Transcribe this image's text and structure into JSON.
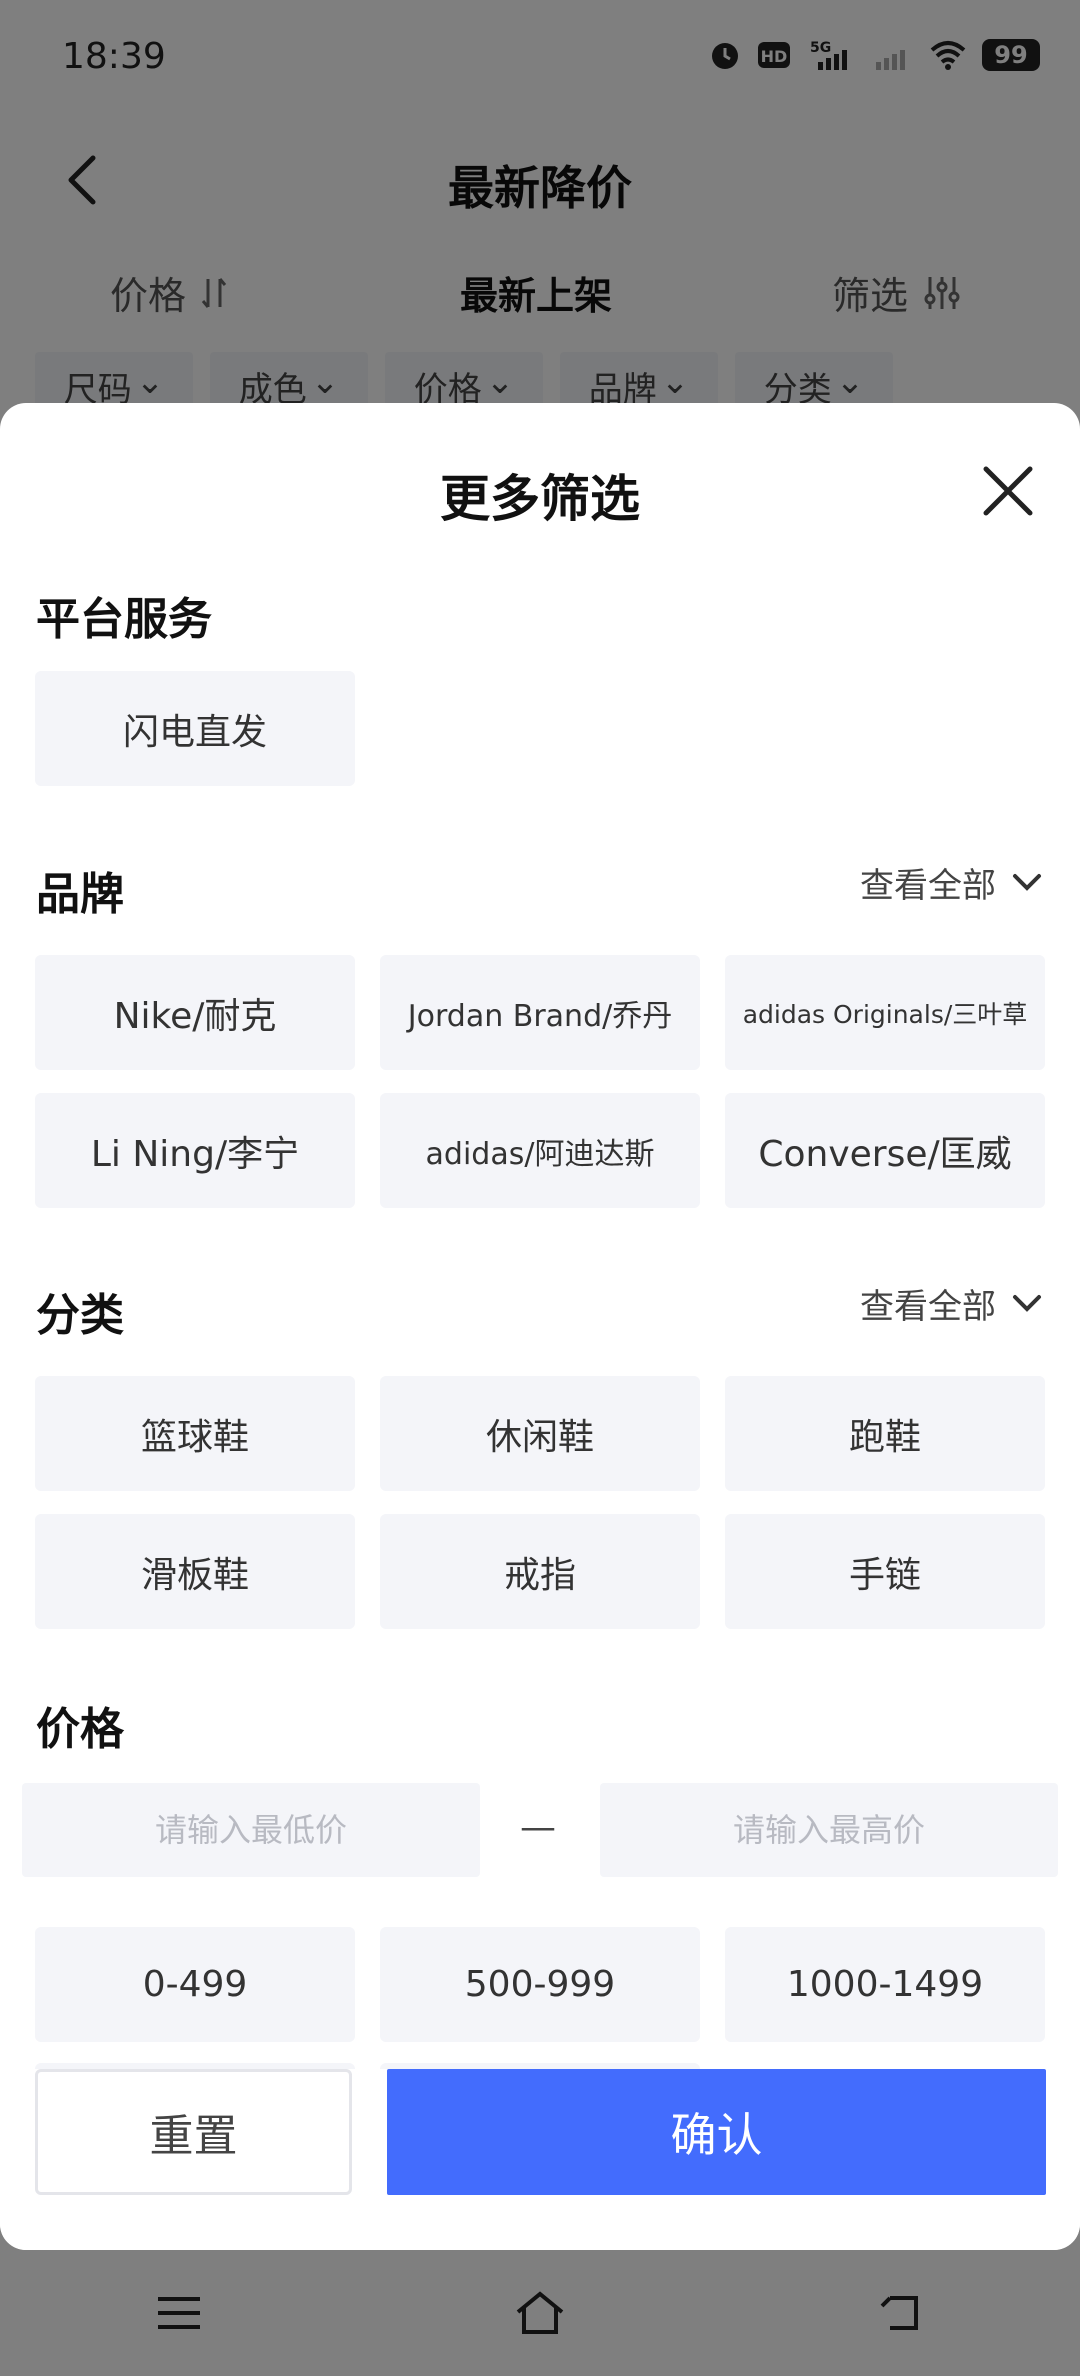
{
  "status_bar": {
    "time": "18:39",
    "battery": "99",
    "network": "5G"
  },
  "nav": {
    "title": "最新降价"
  },
  "sort_bar": {
    "price": "价格",
    "newest": "最新上架",
    "filter": "筛选"
  },
  "quick_filters": [
    "尺码",
    "成色",
    "价格",
    "品牌",
    "分类"
  ],
  "sheet": {
    "title": "更多筛选",
    "platform": {
      "title": "平台服务",
      "options": [
        "闪电直发"
      ]
    },
    "brand": {
      "title": "品牌",
      "view_all": "查看全部",
      "options": [
        "Nike/耐克",
        "Jordan Brand/乔丹",
        "adidas Originals/三叶草",
        "Li Ning/李宁",
        "adidas/阿迪达斯",
        "Converse/匡威"
      ]
    },
    "category": {
      "title": "分类",
      "view_all": "查看全部",
      "options": [
        "篮球鞋",
        "休闲鞋",
        "跑鞋",
        "滑板鞋",
        "戒指",
        "手链"
      ]
    },
    "price": {
      "title": "价格",
      "min_placeholder": "请输入最低价",
      "max_placeholder": "请输入最高价",
      "dash": "—",
      "ranges": [
        "0-499",
        "500-999",
        "1000-1499"
      ]
    },
    "reset_label": "重置",
    "confirm_label": "确认"
  },
  "colors": {
    "accent": "#436cfd",
    "option_bg": "#f4f5f9",
    "overlay": "rgba(0,0,0,0.5)"
  }
}
